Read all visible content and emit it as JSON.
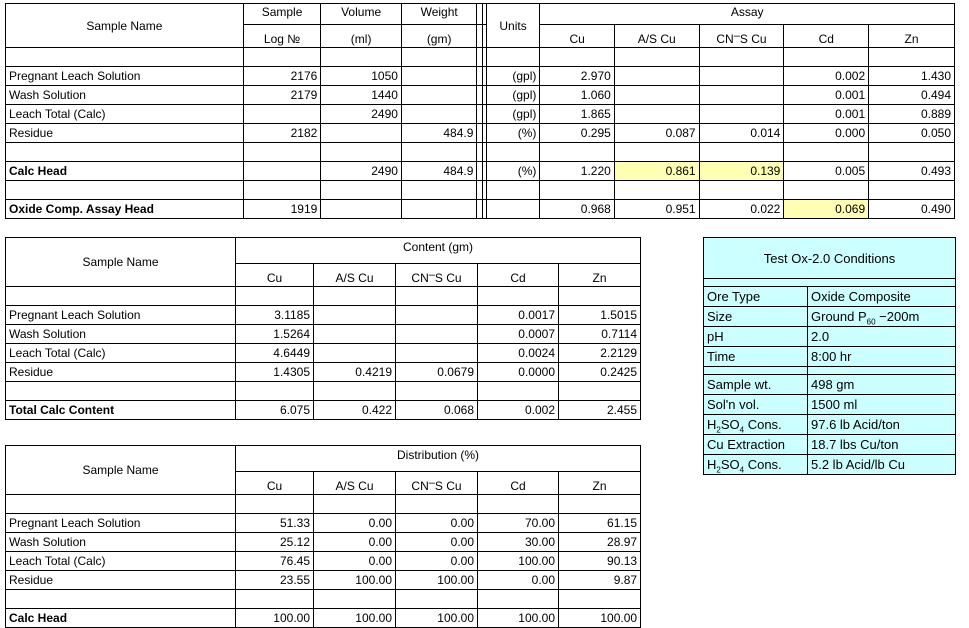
{
  "assay_table": {
    "headers": {
      "sample_name": "Sample Name",
      "sample_log_1": "Sample",
      "sample_log_2": "Log №",
      "volume_1": "Volume",
      "volume_2": "(ml)",
      "weight_1": "Weight",
      "weight_2": "(gm)",
      "units": "Units",
      "group": "Assay",
      "cu": "Cu",
      "as_cu": "A/S Cu",
      "cns_cu_pre": "CN",
      "cns_cu_post": "S Cu",
      "cd": "Cd",
      "zn": "Zn"
    },
    "rows": [
      {
        "name": "Pregnant Leach Solution",
        "log": "2176",
        "volume": "1050",
        "weight": "",
        "units": "(gpl)",
        "cu": "2.970",
        "as_cu": "",
        "cns_cu": "",
        "cd": "0.002",
        "zn": "1.430",
        "bold": false
      },
      {
        "name": "Wash Solution",
        "log": "2179",
        "volume": "1440",
        "weight": "",
        "units": "(gpl)",
        "cu": "1.060",
        "as_cu": "",
        "cns_cu": "",
        "cd": "0.001",
        "zn": "0.494",
        "bold": false
      },
      {
        "name": "Leach Total (Calc)",
        "log": "",
        "volume": "2490",
        "weight": "",
        "units": "(gpl)",
        "cu": "1.865",
        "as_cu": "",
        "cns_cu": "",
        "cd": "0.001",
        "zn": "0.889",
        "bold": false
      },
      {
        "name": "Residue",
        "log": "2182",
        "volume": "",
        "weight": "484.9",
        "units": "(%)",
        "cu": "0.295",
        "as_cu": "0.087",
        "cns_cu": "0.014",
        "cd": "0.000",
        "zn": "0.050",
        "bold": false
      },
      {
        "name": "Calc Head",
        "log": "",
        "volume": "2490",
        "weight": "484.9",
        "units": "(%)",
        "cu": "1.220",
        "as_cu": "0.861",
        "cns_cu": "0.139",
        "cd": "0.005",
        "zn": "0.493",
        "bold": true
      },
      {
        "name": "Oxide Comp. Assay Head",
        "log": "1919",
        "volume": "",
        "weight": "",
        "units": "",
        "cu": "0.968",
        "as_cu": "0.951",
        "cns_cu": "0.022",
        "cd": "0.069",
        "zn": "0.490",
        "bold": true
      }
    ],
    "highlights": [
      "calc-head-as-cu",
      "calc-head-cns-cu",
      "oxide-head-cd"
    ],
    "highlight_color": "#ffffb3"
  },
  "content_table": {
    "headers": {
      "sample_name": "Sample Name",
      "group": "Content (gm)",
      "cu": "Cu",
      "as_cu": "A/S Cu",
      "cns_cu_pre": "CN",
      "cns_cu_post": "S Cu",
      "cd": "Cd",
      "zn": "Zn"
    },
    "rows": [
      {
        "name": "Pregnant Leach Solution",
        "cu": "3.1185",
        "as_cu": "",
        "cns_cu": "",
        "cd": "0.0017",
        "zn": "1.5015",
        "bold": false
      },
      {
        "name": "Wash Solution",
        "cu": "1.5264",
        "as_cu": "",
        "cns_cu": "",
        "cd": "0.0007",
        "zn": "0.7114",
        "bold": false
      },
      {
        "name": "Leach Total (Calc)",
        "cu": "4.6449",
        "as_cu": "",
        "cns_cu": "",
        "cd": "0.0024",
        "zn": "2.2129",
        "bold": false
      },
      {
        "name": "Residue",
        "cu": "1.4305",
        "as_cu": "0.4219",
        "cns_cu": "0.0679",
        "cd": "0.0000",
        "zn": "0.2425",
        "bold": false
      },
      {
        "name": "Total Calc Content",
        "cu": "6.075",
        "as_cu": "0.422",
        "cns_cu": "0.068",
        "cd": "0.002",
        "zn": "2.455",
        "bold": true
      }
    ]
  },
  "distribution_table": {
    "headers": {
      "sample_name": "Sample Name",
      "group": "Distribution (%)",
      "cu": "Cu",
      "as_cu": "A/S Cu",
      "cns_cu_pre": "CN",
      "cns_cu_post": "S Cu",
      "cd": "Cd",
      "zn": "Zn"
    },
    "rows": [
      {
        "name": "Pregnant Leach Solution",
        "cu": "51.33",
        "as_cu": "0.00",
        "cns_cu": "0.00",
        "cd": "70.00",
        "zn": "61.15",
        "bold": false
      },
      {
        "name": "Wash Solution",
        "cu": "25.12",
        "as_cu": "0.00",
        "cns_cu": "0.00",
        "cd": "30.00",
        "zn": "28.97",
        "bold": false
      },
      {
        "name": "Leach Total (Calc)",
        "cu": "76.45",
        "as_cu": "0.00",
        "cns_cu": "0.00",
        "cd": "100.00",
        "zn": "90.13",
        "bold": false
      },
      {
        "name": "Residue",
        "cu": "23.55",
        "as_cu": "100.00",
        "cns_cu": "100.00",
        "cd": "0.00",
        "zn": "9.87",
        "bold": false
      },
      {
        "name": "Calc Head",
        "cu": "100.00",
        "as_cu": "100.00",
        "cns_cu": "100.00",
        "cd": "100.00",
        "zn": "100.00",
        "bold": true
      }
    ]
  },
  "conditions_panel": {
    "title": "Test Ox-2.0 Conditions",
    "background_color": "#ccffff",
    "group_one": [
      {
        "key": "Ore Type",
        "value": "Oxide Composite"
      },
      {
        "key": "Size",
        "value_pre": "Ground P",
        "value_sub": "60",
        "value_post": " −200m"
      },
      {
        "key": "pH",
        "value": "2.0"
      },
      {
        "key": "Time",
        "value": "8:00 hr"
      }
    ],
    "group_two": [
      {
        "key": "Sample wt.",
        "value": "498 gm"
      },
      {
        "key": "Sol'n vol.",
        "value": "1500 ml"
      },
      {
        "key_pre": "H",
        "key_sub": "2",
        "key_mid": "SO",
        "key_sub2": "4",
        "key_post": " Cons.",
        "value": "97.6 lb Acid/ton"
      },
      {
        "key": "Cu Extraction",
        "value": "18.7 lbs Cu/ton"
      },
      {
        "key_pre": "H",
        "key_sub": "2",
        "key_mid": "SO",
        "key_sub2": "4",
        "key_post": " Cons.",
        "value": "5.2 lb Acid/lb Cu"
      }
    ]
  }
}
